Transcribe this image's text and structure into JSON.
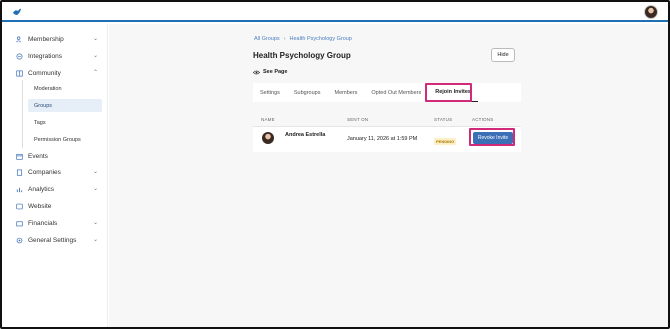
{
  "sidebar": {
    "items": [
      {
        "label": "Membership",
        "icon": "users-icon",
        "chevron": "down"
      },
      {
        "label": "Integrations",
        "icon": "plug-icon",
        "chevron": "down"
      },
      {
        "label": "Community",
        "icon": "book-icon",
        "chevron": "up"
      },
      {
        "label": "Events",
        "icon": "calendar-icon",
        "chevron": ""
      },
      {
        "label": "Companies",
        "icon": "building-icon",
        "chevron": "down"
      },
      {
        "label": "Analytics",
        "icon": "bar-chart-icon",
        "chevron": "down"
      },
      {
        "label": "Website",
        "icon": "globe-icon",
        "chevron": ""
      },
      {
        "label": "Financials",
        "icon": "wallet-icon",
        "chevron": "down"
      },
      {
        "label": "General Settings",
        "icon": "gear-icon",
        "chevron": "down"
      }
    ],
    "community_subitems": [
      "Moderation",
      "Groups",
      "Tags",
      "Permission Groups"
    ],
    "active_subitem": "Groups"
  },
  "breadcrumb": {
    "root": "All Groups",
    "separator": "›",
    "current": "Health Psychology Group"
  },
  "page": {
    "title": "Health Psychology Group",
    "hide_label": "Hide",
    "see_page_label": "See Page"
  },
  "tabs": [
    "Settings",
    "Subgroups",
    "Members",
    "Opted Out Members",
    "Rejoin Invites"
  ],
  "active_tab": "Rejoin Invites",
  "table": {
    "headers": {
      "name": "NAME",
      "sent_on": "SENT ON",
      "status": "STATUS",
      "actions": "ACTIONS"
    },
    "rows": [
      {
        "name": "Andrea Estrella",
        "sent_on": "January 11, 2026 at 1:59 PM",
        "status": "PENDING",
        "action": "Revoke Invite"
      }
    ]
  },
  "colors": {
    "accent": "#3b6fb6",
    "highlight": "#d12a7a",
    "pending_bg": "#fdf0c8",
    "pending_text": "#a67c00"
  }
}
